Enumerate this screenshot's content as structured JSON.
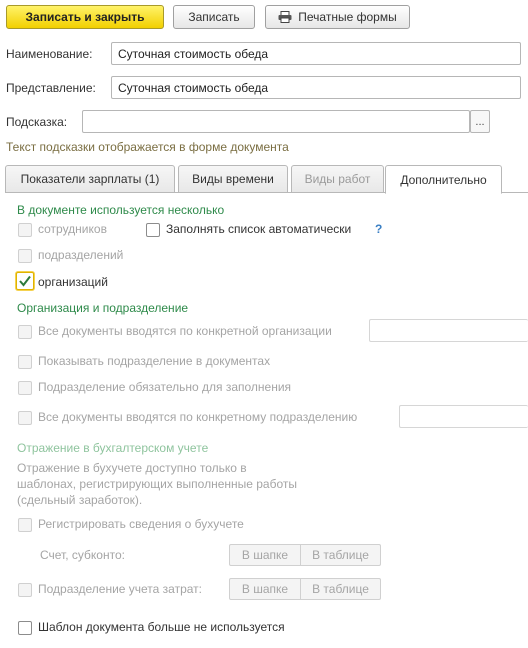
{
  "toolbar": {
    "save_close_label": "Записать и закрыть",
    "save_label": "Записать",
    "print_label": "Печатные формы",
    "print_icon": "printer-icon"
  },
  "fields": {
    "name_label": "Наименование:",
    "name_value": "Суточная стоимость обеда",
    "presentation_label": "Представление:",
    "presentation_value": "Суточная стоимость обеда",
    "hint_label": "Подсказка:",
    "hint_value": "",
    "hint_button": "...",
    "hint_note": "Текст подсказки отображается в форме документа"
  },
  "tabs": [
    {
      "label": "Показатели зарплаты (1)",
      "active": false,
      "disabled": false
    },
    {
      "label": "Виды времени",
      "active": false,
      "disabled": false
    },
    {
      "label": "Виды работ",
      "active": false,
      "disabled": true
    },
    {
      "label": "Дополнительно",
      "active": true,
      "disabled": false
    }
  ],
  "multi": {
    "title": "В документе используется несколько",
    "employees": "сотрудников",
    "autofill": "Заполнять список автоматически",
    "help": "?",
    "departments": "подразделений",
    "organizations": "организаций"
  },
  "org": {
    "title": "Организация и подразделение",
    "all_docs_org": "Все документы вводятся по конкретной организации",
    "show_dept": "Показывать подразделение в документах",
    "dept_required": "Подразделение обязательно для заполнения",
    "all_docs_dept": "Все документы вводятся по конкретному подразделению"
  },
  "accounting": {
    "title": "Отражение в бухгалтерском учете",
    "note_lines": [
      "Отражение в бухучете доступно только в",
      "шаблонах, регистрирующих выполненные работы",
      "(сдельный заработок)."
    ],
    "register": "Регистрировать сведения о бухучете",
    "account_label": "Счет, субконто:",
    "in_header": "В шапке",
    "in_table": "В таблице",
    "cost_center": "Подразделение учета затрат:",
    "in_header2": "В шапке",
    "in_table2": "В таблице"
  },
  "footer": {
    "unused": "Шаблон документа больше не используется"
  }
}
